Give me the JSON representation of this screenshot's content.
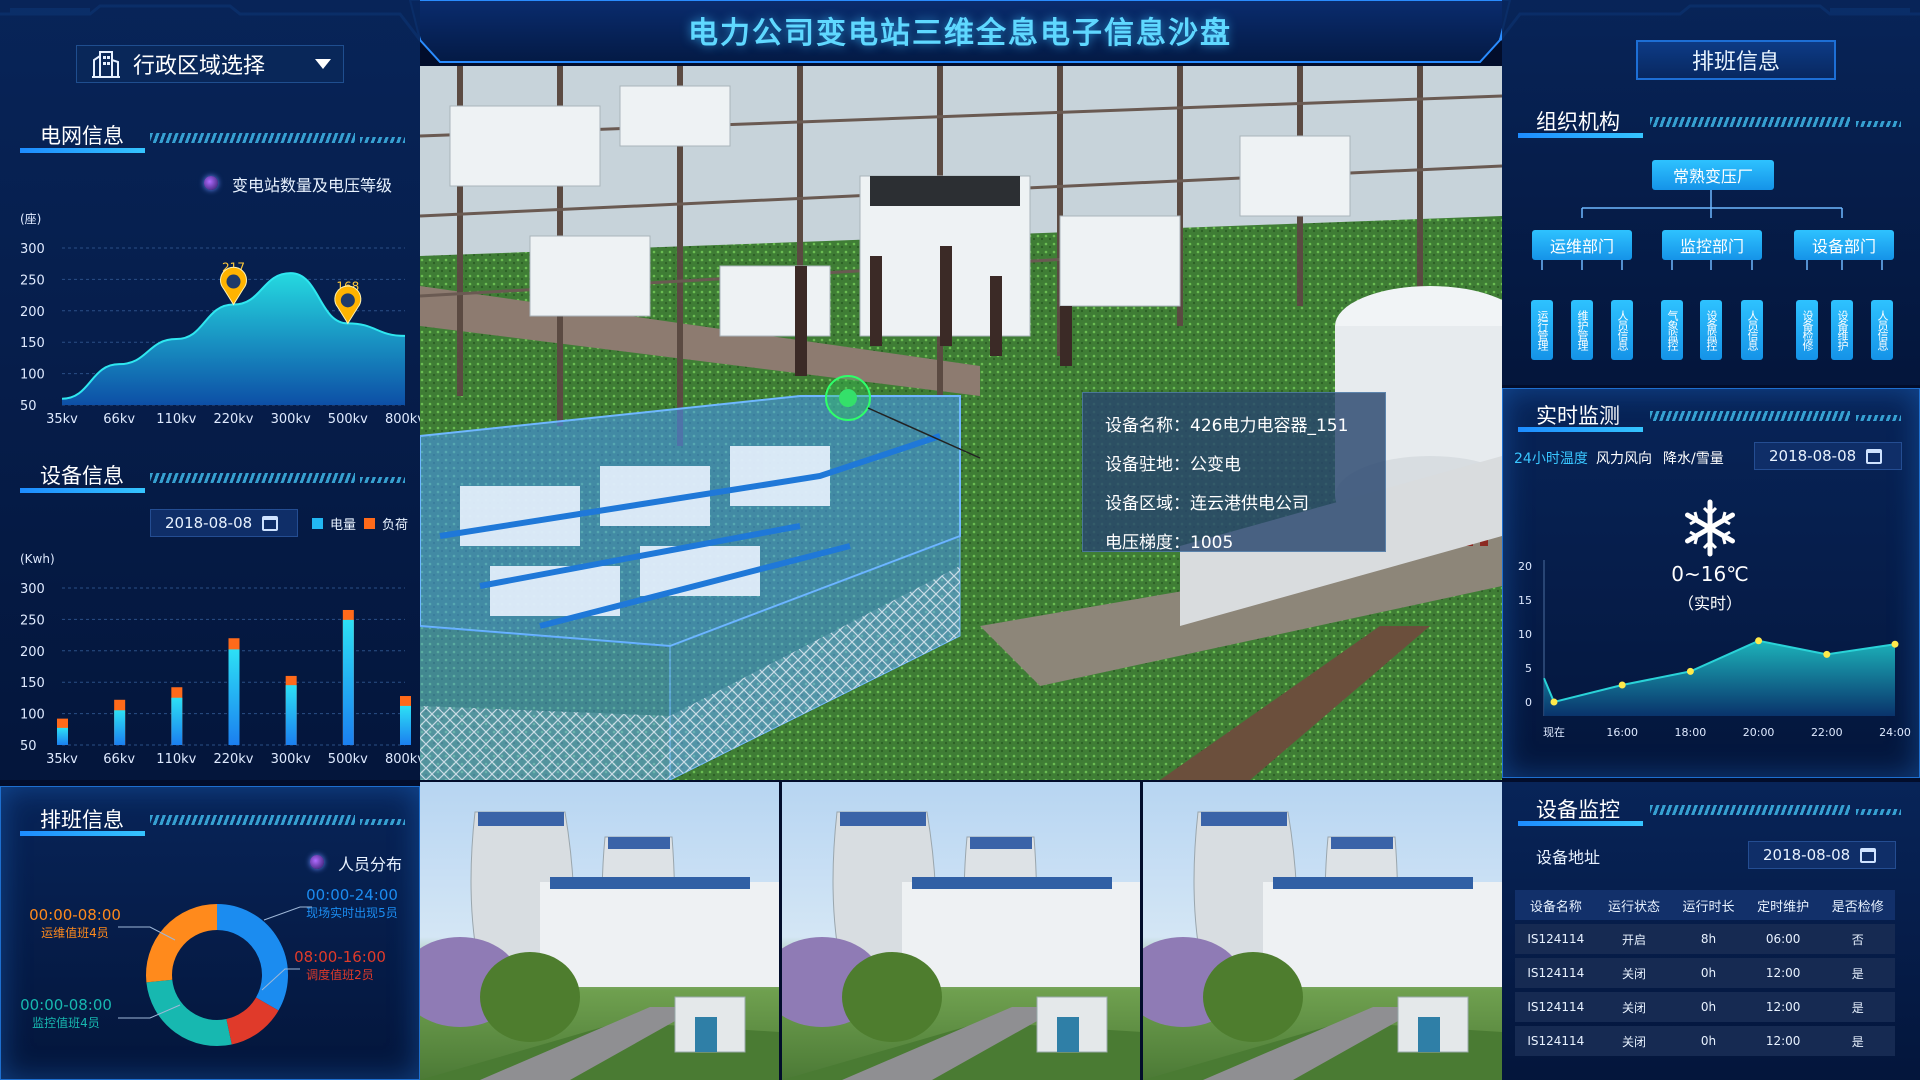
{
  "header": {
    "title": "电力公司变电站三维全息电子信息沙盘"
  },
  "region": {
    "label": "行政区域选择"
  },
  "grid": {
    "title": "电网信息",
    "legend": "变电站数量及电压等级",
    "unit": "(座)",
    "chart_data": {
      "type": "area",
      "categories": [
        "35kv",
        "66kv",
        "110kv",
        "220kv",
        "300kv",
        "500kv",
        "800kv"
      ],
      "values": [
        60,
        115,
        155,
        210,
        260,
        180,
        160
      ],
      "ylim": [
        50,
        300
      ],
      "yticks": [
        "300",
        "250",
        "200",
        "150",
        "100",
        "50"
      ],
      "markers": [
        {
          "category": "220kv",
          "label": "217"
        },
        {
          "category": "500kv",
          "label": "168"
        }
      ]
    }
  },
  "equipment": {
    "title": "设备信息",
    "date": "2018-08-08",
    "legend_power": "电量",
    "legend_load": "负荷",
    "unit": "(Kwh)",
    "colors": {
      "power": "#22b7f2",
      "load": "#ff6a1a"
    },
    "chart_data": {
      "type": "bar",
      "categories": [
        "35kv",
        "66kv",
        "110kv",
        "220kv",
        "300kv",
        "500kv",
        "800kv"
      ],
      "ylim": [
        50,
        300
      ],
      "yticks": [
        "300",
        "250",
        "200",
        "150",
        "100",
        "50"
      ],
      "series": [
        {
          "name": "电量",
          "values": [
            90,
            118,
            138,
            215,
            158,
            262,
            125
          ]
        },
        {
          "name": "负荷",
          "values": [
            92,
            122,
            142,
            220,
            160,
            265,
            128
          ]
        }
      ]
    }
  },
  "schedule_left": {
    "title": "排班信息",
    "legend": "人员分布",
    "chart_data": {
      "type": "pie",
      "slices": [
        {
          "time": "00:00-24:00",
          "desc": "现场实时出现5员",
          "value": 5,
          "color": "#1b8cf0"
        },
        {
          "time": "08:00-16:00",
          "desc": "调度值班2员",
          "value": 2,
          "color": "#e03a2a"
        },
        {
          "time": "00:00-08:00",
          "desc": "监控值班4员",
          "value": 4,
          "color": "#17b8b0"
        },
        {
          "time": "00:00-08:00",
          "desc": "运维值班4员",
          "value": 4,
          "color": "#ff8a1c"
        }
      ]
    }
  },
  "device_card": {
    "rows": [
      "设备名称：426电力电容器_151",
      "设备驻地：公变电",
      "设备区域：连云港供电公司",
      "电压梯度：1005"
    ]
  },
  "right_schedule": {
    "header": "排班信息",
    "title": "组织机构",
    "root": "常熟变压厂",
    "departments": [
      "运维部门",
      "监控部门",
      "设备部门"
    ],
    "leaves": [
      "运行管理",
      "维护管理",
      "人员信息",
      "气象监控",
      "设备监控",
      "人员信息",
      "设备检修",
      "设备维护",
      "人员信息"
    ]
  },
  "monitor": {
    "title": "实时监测",
    "tabs": [
      "24小时温度",
      "风力风向",
      "降水/雪量"
    ],
    "date": "2018-08-08",
    "weather_icon": "snowflake-icon",
    "temperature": "0~16℃",
    "temperature_note": "（实时）",
    "chart_data": {
      "type": "area",
      "x": [
        "现在",
        "16:00",
        "18:00",
        "20:00",
        "22:00",
        "24:00"
      ],
      "values": [
        0,
        2.5,
        4.5,
        9,
        7,
        8.5
      ],
      "ylim": [
        0,
        20
      ],
      "yticks": [
        "20",
        "15",
        "10",
        "5",
        "0"
      ]
    }
  },
  "device_monitor": {
    "title": "设备监控",
    "address_label": "设备地址",
    "date": "2018-08-08",
    "columns": [
      "设备名称",
      "运行状态",
      "运行时长",
      "定时维护",
      "是否检修"
    ],
    "rows": [
      [
        "IS124114",
        "开启",
        "8h",
        "06:00",
        "否"
      ],
      [
        "IS124114",
        "关闭",
        "0h",
        "12:00",
        "是"
      ],
      [
        "IS124114",
        "关闭",
        "0h",
        "12:00",
        "是"
      ],
      [
        "IS124114",
        "关闭",
        "0h",
        "12:00",
        "是"
      ]
    ]
  }
}
